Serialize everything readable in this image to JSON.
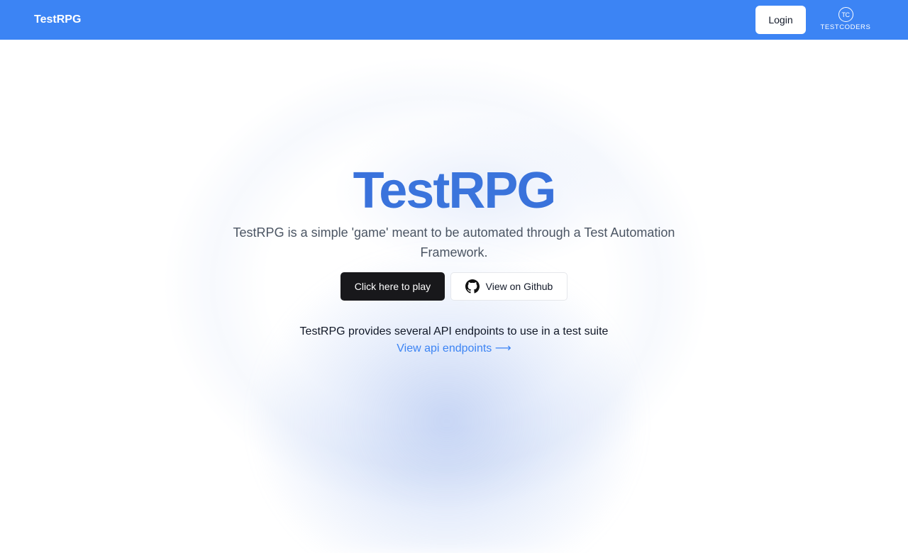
{
  "nav": {
    "brand": "TestRPG",
    "login_label": "Login",
    "logo_monogram": "TC",
    "logo_text": "TESTCODERS"
  },
  "hero": {
    "title": "TestRPG",
    "description": "TestRPG is a simple 'game' meant to be automated through a Test Automation Framework.",
    "play_label": "Click here to play",
    "github_label": "View on Github",
    "api_text": "TestRPG provides several API endpoints to use in a test suite",
    "api_link_label": "View api endpoints"
  },
  "colors": {
    "nav_background": "#3c84f4",
    "title_gradient": "#3467d9",
    "play_button": "#18181b",
    "link": "#3c84f4"
  },
  "icons": {
    "github": "github-icon",
    "arrow": "arrow-right-icon"
  }
}
